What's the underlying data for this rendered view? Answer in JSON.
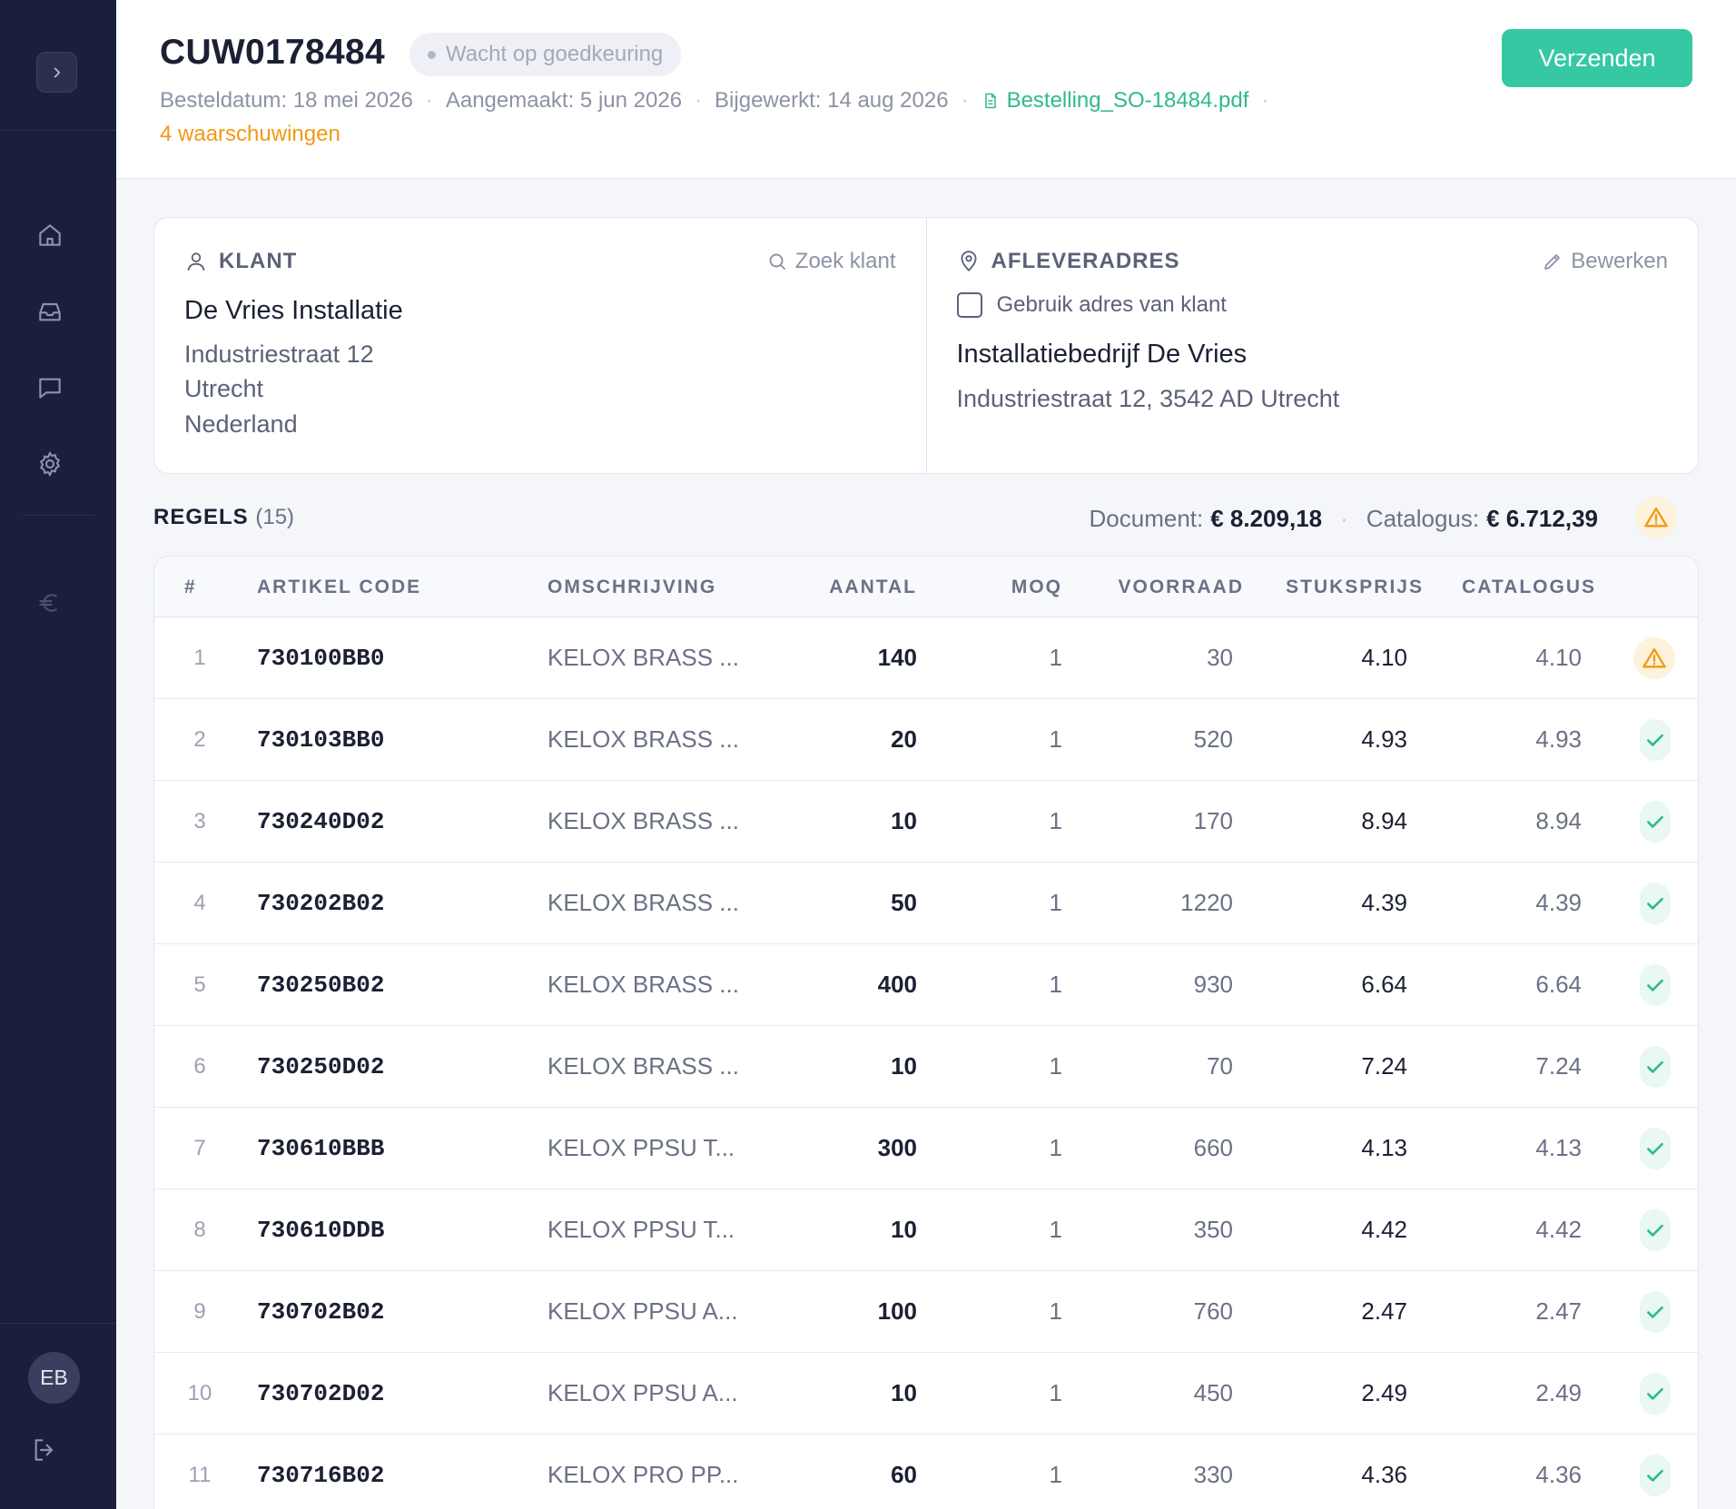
{
  "sidebar": {
    "icons": [
      "chevron-right-icon",
      "home-icon",
      "inbox-icon",
      "chat-icon",
      "gear-icon",
      "euro-icon",
      "logout-icon"
    ],
    "user_initials": "EB"
  },
  "header": {
    "order_id": "CUW0178484",
    "status": "Wacht op goedkeuring",
    "order_date": "Besteldatum: 18 mei 2026",
    "created": "Aangemaakt: 5 jun 2026",
    "updated": "Bijgewerkt: 14 aug 2026",
    "pdf_file": "Bestelling_SO-18484.pdf",
    "separator": "·",
    "warnings": "4 waarschuwingen",
    "send_label": "Verzenden"
  },
  "customer": {
    "title": "KLANT",
    "search_label": "Zoek klant",
    "name": "De Vries Installatie",
    "street": "Industriestraat 12",
    "city": "Utrecht",
    "country": "Nederland"
  },
  "delivery": {
    "title": "AFLEVERADRES",
    "edit_label": "Bewerken",
    "use_customer_address_label": "Gebruik adres van klant",
    "use_customer_address_checked": false,
    "name": "Installatiebedrijf De Vries",
    "address": "Industriestraat 12, 3542 AD Utrecht"
  },
  "lines": {
    "title": "REGELS",
    "count": "(15)",
    "document_label": "Document:",
    "document_total": "€ 8.209,18",
    "catalog_label": "Catalogus:",
    "catalog_total": "€ 6.712,39",
    "columns": [
      "#",
      "ARTIKEL CODE",
      "OMSCHRIJVING",
      "AANTAL",
      "MOQ",
      "VOORRAAD",
      "STUKSPRIJS",
      "CATALOGUS"
    ],
    "rows": [
      {
        "num": "1",
        "code": "730100BB0",
        "desc": "KELOX BRASS ...",
        "qty": "140",
        "moq": "1",
        "stock": "30",
        "price": "4.10",
        "catalog": "4.10",
        "status": "warning"
      },
      {
        "num": "2",
        "code": "730103BB0",
        "desc": "KELOX BRASS ...",
        "qty": "20",
        "moq": "1",
        "stock": "520",
        "price": "4.93",
        "catalog": "4.93",
        "status": "ok"
      },
      {
        "num": "3",
        "code": "730240D02",
        "desc": "KELOX BRASS ...",
        "qty": "10",
        "moq": "1",
        "stock": "170",
        "price": "8.94",
        "catalog": "8.94",
        "status": "ok"
      },
      {
        "num": "4",
        "code": "730202B02",
        "desc": "KELOX BRASS ...",
        "qty": "50",
        "moq": "1",
        "stock": "1220",
        "price": "4.39",
        "catalog": "4.39",
        "status": "ok"
      },
      {
        "num": "5",
        "code": "730250B02",
        "desc": "KELOX BRASS ...",
        "qty": "400",
        "moq": "1",
        "stock": "930",
        "price": "6.64",
        "catalog": "6.64",
        "status": "ok"
      },
      {
        "num": "6",
        "code": "730250D02",
        "desc": "KELOX BRASS ...",
        "qty": "10",
        "moq": "1",
        "stock": "70",
        "price": "7.24",
        "catalog": "7.24",
        "status": "ok"
      },
      {
        "num": "7",
        "code": "730610BBB",
        "desc": "KELOX PPSU T...",
        "qty": "300",
        "moq": "1",
        "stock": "660",
        "price": "4.13",
        "catalog": "4.13",
        "status": "ok"
      },
      {
        "num": "8",
        "code": "730610DDB",
        "desc": "KELOX PPSU T...",
        "qty": "10",
        "moq": "1",
        "stock": "350",
        "price": "4.42",
        "catalog": "4.42",
        "status": "ok"
      },
      {
        "num": "9",
        "code": "730702B02",
        "desc": "KELOX PPSU A...",
        "qty": "100",
        "moq": "1",
        "stock": "760",
        "price": "2.47",
        "catalog": "2.47",
        "status": "ok"
      },
      {
        "num": "10",
        "code": "730702D02",
        "desc": "KELOX PPSU A...",
        "qty": "10",
        "moq": "1",
        "stock": "450",
        "price": "2.49",
        "catalog": "2.49",
        "status": "ok"
      },
      {
        "num": "11",
        "code": "730716B02",
        "desc": "KELOX PRO PP...",
        "qty": "60",
        "moq": "1",
        "stock": "330",
        "price": "4.36",
        "catalog": "4.36",
        "status": "ok"
      }
    ]
  },
  "colors": {
    "sidebar_bg": "#1b1f3b",
    "accent": "#35c8a2",
    "warning": "#ef9a15",
    "ok": "#2fb98f"
  }
}
